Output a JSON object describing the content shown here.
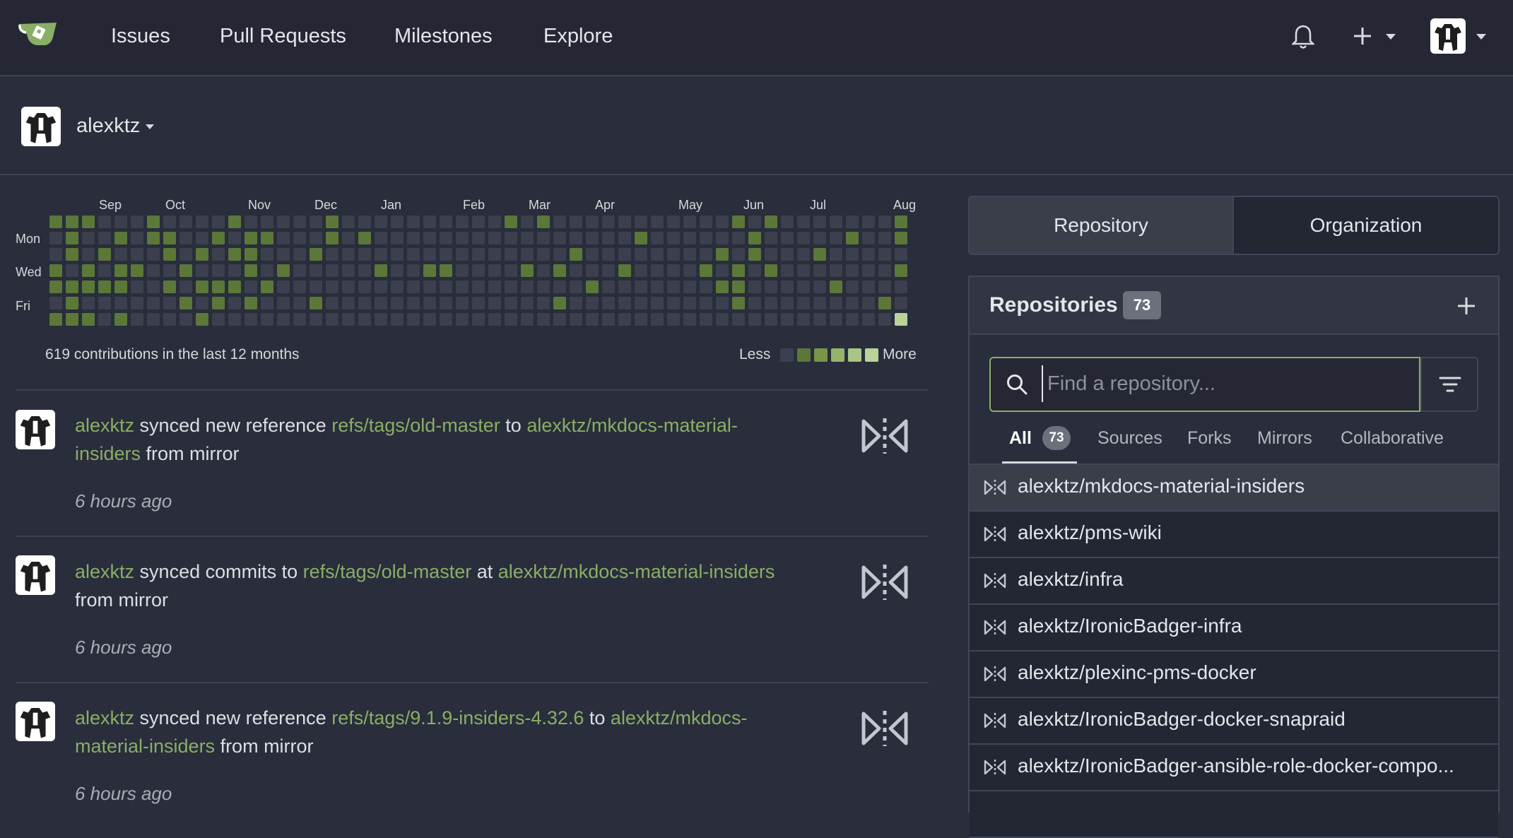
{
  "nav": {
    "links": [
      "Issues",
      "Pull Requests",
      "Milestones",
      "Explore"
    ],
    "icons": [
      "bell-icon",
      "plus-icon",
      "avatar"
    ]
  },
  "context": {
    "username": "alexktz"
  },
  "heatmap": {
    "months": [
      "Sep",
      "Oct",
      "Nov",
      "Dec",
      "Jan",
      "Feb",
      "Mar",
      "Apr",
      "May",
      "Jun",
      "Jul",
      "Aug"
    ],
    "days": [
      "Mon",
      "Wed",
      "Fri"
    ],
    "summary": "619 contributions in the last 12 months",
    "less": "Less",
    "more": "More",
    "colors": [
      "#3b3f4e",
      "#4e6136",
      "#5b7838",
      "#789548",
      "#96b36c",
      "#b9d39a"
    ]
  },
  "feed": [
    {
      "actor": "alexktz",
      "verb": " synced new reference ",
      "ref": "refs/tags/old-master",
      "mid": " to ",
      "repo": "alexktz/mkdocs-material-insiders",
      "tail": " from mirror",
      "time": "6 hours ago"
    },
    {
      "actor": "alexktz",
      "verb": " synced commits to ",
      "ref": "refs/tags/old-master",
      "mid": " at ",
      "repo": "alexktz/mkdocs-material-insiders",
      "tail": " from mirror",
      "time": "6 hours ago"
    },
    {
      "actor": "alexktz",
      "verb": " synced new reference ",
      "ref": "refs/tags/9.1.9-insiders-4.32.6",
      "mid": " to ",
      "repo": "alexktz/mkdocs-material-insiders",
      "tail": " from mirror",
      "time": "6 hours ago"
    }
  ],
  "panel": {
    "seg_repository": "Repository",
    "seg_organization": "Organization",
    "title": "Repositories",
    "count": "73",
    "search_placeholder": "Find a repository...",
    "tabs": [
      {
        "label": "All",
        "count": "73"
      },
      {
        "label": "Sources"
      },
      {
        "label": "Forks"
      },
      {
        "label": "Mirrors"
      },
      {
        "label": "Collaborative"
      }
    ],
    "repos": [
      "alexktz/mkdocs-material-insiders",
      "alexktz/pms-wiki",
      "alexktz/infra",
      "alexktz/IronicBadger-infra",
      "alexktz/plexinc-pms-docker",
      "alexktz/IronicBadger-docker-snapraid",
      "alexktz/IronicBadger-ansible-role-docker-compo..."
    ]
  }
}
